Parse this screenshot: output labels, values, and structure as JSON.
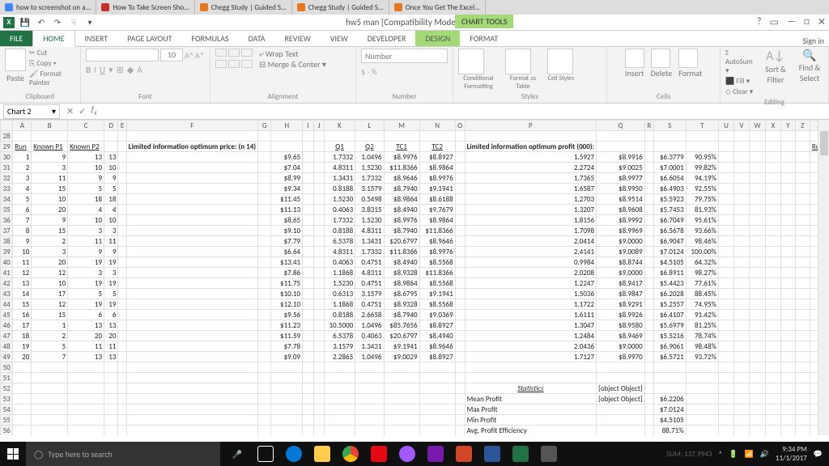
{
  "browser_tabs": [
    {
      "color": "#4285f4",
      "label": "how to screenshot on a..."
    },
    {
      "color": "#c4302b",
      "label": "How To Take Screen Sho..."
    },
    {
      "color": "#e87722",
      "label": "Chegg Study | Guided S..."
    },
    {
      "color": "#e87722",
      "label": "Chegg Study | Guided S..."
    },
    {
      "color": "#e87722",
      "label": "Once You Get The Excel..."
    }
  ],
  "titlebar": {
    "title": "hw5 man  [Compatibility Mode] - Excel",
    "chart_tools": "CHART TOOLS"
  },
  "ribbon_tabs": {
    "file": "FILE",
    "home": "HOME",
    "insert": "INSERT",
    "page_layout": "PAGE LAYOUT",
    "formulas": "FORMULAS",
    "data": "DATA",
    "review": "REVIEW",
    "view": "VIEW",
    "developer": "DEVELOPER",
    "design": "DESIGN",
    "format": "FORMAT",
    "signin": "Sign in"
  },
  "ribbon": {
    "clipboard": {
      "paste": "Paste",
      "cut": "Cut",
      "copy": "Copy",
      "painter": "Format Painter",
      "label": "Clipboard"
    },
    "font": {
      "size": "10",
      "label": "Font"
    },
    "alignment": {
      "wrap": "Wrap Text",
      "merge": "Merge & Center",
      "label": "Alignment"
    },
    "number": {
      "fmt": "Number",
      "sym": "$ - %",
      "label": "Number"
    },
    "styles": {
      "cond": "Conditional Formatting",
      "table": "Format as Table",
      "cell": "Cell Styles",
      "label": "Styles"
    },
    "cells": {
      "insert": "Insert",
      "delete": "Delete",
      "format": "Format",
      "label": "Cells"
    },
    "editing": {
      "autosum": "AutoSum",
      "fill": "Fill",
      "clear": "Clear",
      "sort": "Sort & Filter",
      "find": "Find & Select",
      "label": "Editing"
    }
  },
  "namebox": "Chart 2",
  "columns": [
    "",
    "A",
    "B",
    "C",
    "D",
    "E",
    "F",
    "G",
    "H",
    "I",
    "J",
    "K",
    "L",
    "M",
    "N",
    "O",
    "P",
    "Q",
    "R",
    "S",
    "T",
    "U",
    "V",
    "W",
    "X",
    "Y",
    "Z",
    "A"
  ],
  "header_row": 29,
  "hdr": {
    "run": "Run",
    "kp1": "Known P1",
    "kp2": "Known P2",
    "price": "Limited information optimum price: (n 14)",
    "q1": "Q1",
    "q2": "Q2",
    "tc1": "TC1",
    "tc2": "TC2",
    "profit": "Limited information optimum profit (000):"
  },
  "rows": [
    {
      "r": 30,
      "a": 1,
      "b": 9,
      "c": 13,
      "d": 13,
      "h": "$9.65",
      "k": "1.7332",
      "l": "1.0496",
      "m": "$8.9976",
      "n": "$8.8927",
      "p": "1.5927",
      "q": "$8.9916",
      "s": "$6.3779",
      "t": "90.95%"
    },
    {
      "r": 31,
      "a": 2,
      "b": 3,
      "c": 10,
      "d": 10,
      "h": "$7.04",
      "k": "4.8311",
      "l": "1.5230",
      "m": "$11.8366",
      "n": "$8.9864",
      "p": "2.2724",
      "q": "$9.0025",
      "s": "$7.0001",
      "t": "99.82%"
    },
    {
      "r": 32,
      "a": 3,
      "b": 11,
      "c": 9,
      "d": 9,
      "h": "$8.99",
      "k": "1.3431",
      "l": "1.7332",
      "m": "$8.9646",
      "n": "$8.9976",
      "p": "1.7365",
      "q": "$8.9977",
      "s": "$6.6054",
      "t": "94.19%"
    },
    {
      "r": 33,
      "a": 4,
      "b": 15,
      "c": 5,
      "d": 5,
      "h": "$9.34",
      "k": "0.8188",
      "l": "3.1579",
      "m": "$8.7940",
      "n": "$9.1941",
      "p": "1.6587",
      "q": "$8.9950",
      "s": "$6.4903",
      "t": "92.55%"
    },
    {
      "r": 34,
      "a": 5,
      "b": 10,
      "c": 18,
      "d": 18,
      "h": "$11.45",
      "k": "1.5230",
      "l": "0.5498",
      "m": "$8.9864",
      "n": "$8.6188",
      "p": "1.2703",
      "q": "$8.9514",
      "s": "$5.5923",
      "t": "79.75%"
    },
    {
      "r": 35,
      "a": 6,
      "b": 20,
      "c": 4,
      "d": 4,
      "h": "$11.13",
      "k": "0.4063",
      "l": "3.8315",
      "m": "$8.4940",
      "n": "$9.7679",
      "p": "1.3207",
      "q": "$8.9608",
      "s": "$5.7453",
      "t": "81.93%"
    },
    {
      "r": 36,
      "a": 7,
      "b": 9,
      "c": 10,
      "d": 10,
      "h": "$8.65",
      "k": "1.7332",
      "l": "1.5230",
      "m": "$8.9976",
      "n": "$8.9864",
      "p": "1.8156",
      "q": "$8.9992",
      "s": "$6.7049",
      "t": "95.61%"
    },
    {
      "r": 37,
      "a": 8,
      "b": 15,
      "c": 3,
      "d": 3,
      "h": "$9.10",
      "k": "0.8188",
      "l": "4.8311",
      "m": "$8.7940",
      "n": "$11.8366",
      "p": "1.7098",
      "q": "$8.9969",
      "s": "$6.5678",
      "t": "93.66%"
    },
    {
      "r": 38,
      "a": 9,
      "b": 2,
      "c": 11,
      "d": 11,
      "h": "$7.79",
      "k": "6.5378",
      "l": "1.3431",
      "m": "$20.6797",
      "n": "$8.9646",
      "p": "2.0414",
      "q": "$9.0000",
      "s": "$6.9047",
      "t": "98.46%"
    },
    {
      "r": 39,
      "a": 10,
      "b": 3,
      "c": 9,
      "d": 9,
      "h": "$6.64",
      "k": "4.8311",
      "l": "1.7332",
      "m": "$11.8366",
      "n": "$8.9976",
      "p": "2.4141",
      "q": "$9.0089",
      "s": "$7.0124",
      "t": "100.00%"
    },
    {
      "r": 40,
      "a": 11,
      "b": 20,
      "c": 19,
      "d": 19,
      "h": "$13.41",
      "k": "0.4063",
      "l": "0.4751",
      "m": "$8.4940",
      "n": "$8.5568",
      "p": "0.9984",
      "q": "$8.8744",
      "s": "$4.5105",
      "t": "64.32%"
    },
    {
      "r": 41,
      "a": 12,
      "b": 12,
      "c": 3,
      "d": 3,
      "h": "$7.86",
      "k": "1.1868",
      "l": "4.8311",
      "m": "$8.9328",
      "n": "$11.8366",
      "p": "2.0208",
      "q": "$9.0000",
      "s": "$6.8911",
      "t": "98.27%"
    },
    {
      "r": 42,
      "a": 13,
      "b": 10,
      "c": 19,
      "d": 19,
      "h": "$11.75",
      "k": "1.5230",
      "l": "0.4751",
      "m": "$8.9864",
      "n": "$8.5568",
      "p": "1.2247",
      "q": "$8.9417",
      "s": "$5.4423",
      "t": "77.61%"
    },
    {
      "r": 43,
      "a": 14,
      "b": 17,
      "c": 5,
      "d": 5,
      "h": "$10.10",
      "k": "0.6313",
      "l": "3.1579",
      "m": "$8.6795",
      "n": "$9.1941",
      "p": "1.5036",
      "q": "$8.9847",
      "s": "$6.2028",
      "t": "88.45%"
    },
    {
      "r": 44,
      "a": 15,
      "b": 12,
      "c": 19,
      "d": 19,
      "h": "$12.10",
      "k": "1.1868",
      "l": "0.4751",
      "m": "$8.9328",
      "n": "$8.5568",
      "p": "1.1722",
      "q": "$8.9291",
      "s": "$5.2557",
      "t": "74.95%"
    },
    {
      "r": 45,
      "a": 16,
      "b": 15,
      "c": 6,
      "d": 6,
      "h": "$9.56",
      "k": "0.8188",
      "l": "2.6658",
      "m": "$8.7940",
      "n": "$9.0369",
      "p": "1.6111",
      "q": "$8.9926",
      "s": "$6.4107",
      "t": "91.42%"
    },
    {
      "r": 46,
      "a": 17,
      "b": 1,
      "c": 13,
      "d": 13,
      "h": "$11.23",
      "k": "10.5000",
      "l": "1.0496",
      "m": "$85.7656",
      "n": "$8.8927",
      "p": "1.3047",
      "q": "$8.9580",
      "s": "$5.6979",
      "t": "81.25%"
    },
    {
      "r": 47,
      "a": 18,
      "b": 2,
      "c": 20,
      "d": 20,
      "h": "$11.59",
      "k": "6.5378",
      "l": "0.4063",
      "m": "$20.6797",
      "n": "$8.4940",
      "p": "1.2484",
      "q": "$8.9469",
      "s": "$5.5216",
      "t": "78.74%"
    },
    {
      "r": 48,
      "a": 19,
      "b": 5,
      "c": 11,
      "d": 11,
      "h": "$7.78",
      "k": "3.1579",
      "l": "1.3431",
      "m": "$9.1941",
      "n": "$8.9646",
      "p": "2.0436",
      "q": "$9.0000",
      "s": "$6.9061",
      "t": "98.48%"
    },
    {
      "r": 49,
      "a": 20,
      "b": 7,
      "c": 13,
      "d": 13,
      "h": "$9.09",
      "k": "2.2865",
      "l": "1.0496",
      "m": "$9.0029",
      "n": "$8.8927",
      "p": "1.7127",
      "q": "$8.9970",
      "s": "$6.5721",
      "t": "93.72%"
    }
  ],
  "stats": {
    "title": "Statistics",
    "mean": "Mean Profit",
    "mean_v": "$6.2206",
    "max": "Max Profit",
    "max_v": "$7.0124",
    "min": "Min Profit",
    "min_v": "$4.5105",
    "avg": "Avg. Profit Efficiency",
    "avg_v": "88.71%"
  },
  "taskbar": {
    "search": "Type here to search",
    "time": "9:34 PM",
    "date": "11/1/2017",
    "status": "SUM: 137.9943"
  }
}
